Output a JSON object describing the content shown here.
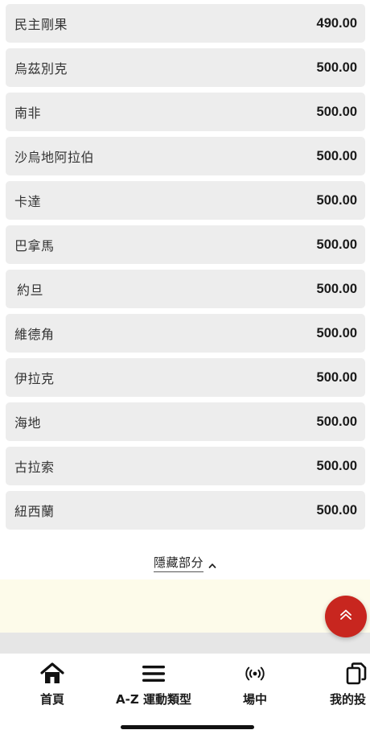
{
  "odds_list": [
    {
      "country": "民主剛果",
      "odds": "490.00"
    },
    {
      "country": "烏茲別克",
      "odds": "500.00"
    },
    {
      "country": "南非",
      "odds": "500.00"
    },
    {
      "country": "沙烏地阿拉伯",
      "odds": "500.00"
    },
    {
      "country": "卡達",
      "odds": "500.00"
    },
    {
      "country": "巴拿馬",
      "odds": "500.00"
    },
    {
      "country": "約旦",
      "odds": "500.00"
    },
    {
      "country": "維德角",
      "odds": "500.00"
    },
    {
      "country": "伊拉克",
      "odds": "500.00"
    },
    {
      "country": "海地",
      "odds": "500.00"
    },
    {
      "country": "古拉索",
      "odds": "500.00"
    },
    {
      "country": "紐西蘭",
      "odds": "500.00"
    }
  ],
  "toggle": {
    "label": "隱藏部分",
    "icon": "chevron-up-icon"
  },
  "scroll_top_button": {
    "icon": "double-chevron-up-icon",
    "color": "#c8261f"
  },
  "bottom_nav": [
    {
      "label": "首頁",
      "icon": "home-icon"
    },
    {
      "label": "A-Z 運動類型",
      "icon": "menu-icon"
    },
    {
      "label": "場中",
      "icon": "live-broadcast-icon"
    },
    {
      "label": "我的投",
      "icon": "copy-icon"
    }
  ]
}
